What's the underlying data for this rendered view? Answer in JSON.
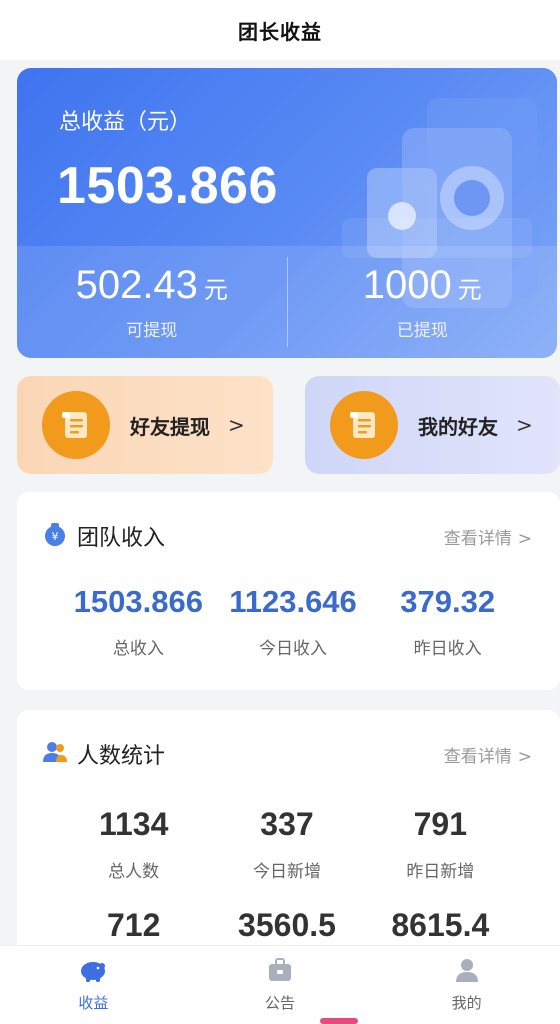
{
  "header": {
    "title": "团长收益"
  },
  "summary": {
    "total_label": "总收益（元）",
    "total_value": "1503.866",
    "withdrawable_value": "502.43",
    "withdrawable_unit": "元",
    "withdrawable_label": "可提现",
    "withdrawn_value": "1000",
    "withdrawn_unit": "元",
    "withdrawn_label": "已提现"
  },
  "quick_actions": [
    {
      "label": "好友提现",
      "chevron": ">",
      "icon": "receipt-icon"
    },
    {
      "label": "我的好友",
      "chevron": ">",
      "icon": "receipt-icon"
    }
  ],
  "team_income": {
    "title": "团队收入",
    "more": "查看详情",
    "more_chevron": ">",
    "icon": "money-bag-icon",
    "stats": [
      {
        "value": "1503.866",
        "label": "总收入"
      },
      {
        "value": "1123.646",
        "label": "今日收入"
      },
      {
        "value": "379.32",
        "label": "昨日收入"
      }
    ]
  },
  "people_stats": {
    "title": "人数统计",
    "more": "查看详情",
    "more_chevron": ">",
    "icon": "users-icon",
    "stats": [
      {
        "value": "1134",
        "label": "总人数"
      },
      {
        "value": "337",
        "label": "今日新增"
      },
      {
        "value": "791",
        "label": "昨日新增"
      },
      {
        "value": "712"
      },
      {
        "value": "3560.5"
      },
      {
        "value": "8615.4"
      }
    ]
  },
  "tabbar": {
    "tabs": [
      {
        "label": "收益",
        "icon": "piggy-bank-icon",
        "active": true
      },
      {
        "label": "公告",
        "icon": "briefcase-icon",
        "active": false
      },
      {
        "label": "我的",
        "icon": "user-icon",
        "active": false
      }
    ]
  },
  "colors": {
    "accent": "#3d6fe0",
    "hero_start": "#3f74ef",
    "orange": "#f29a1c"
  }
}
